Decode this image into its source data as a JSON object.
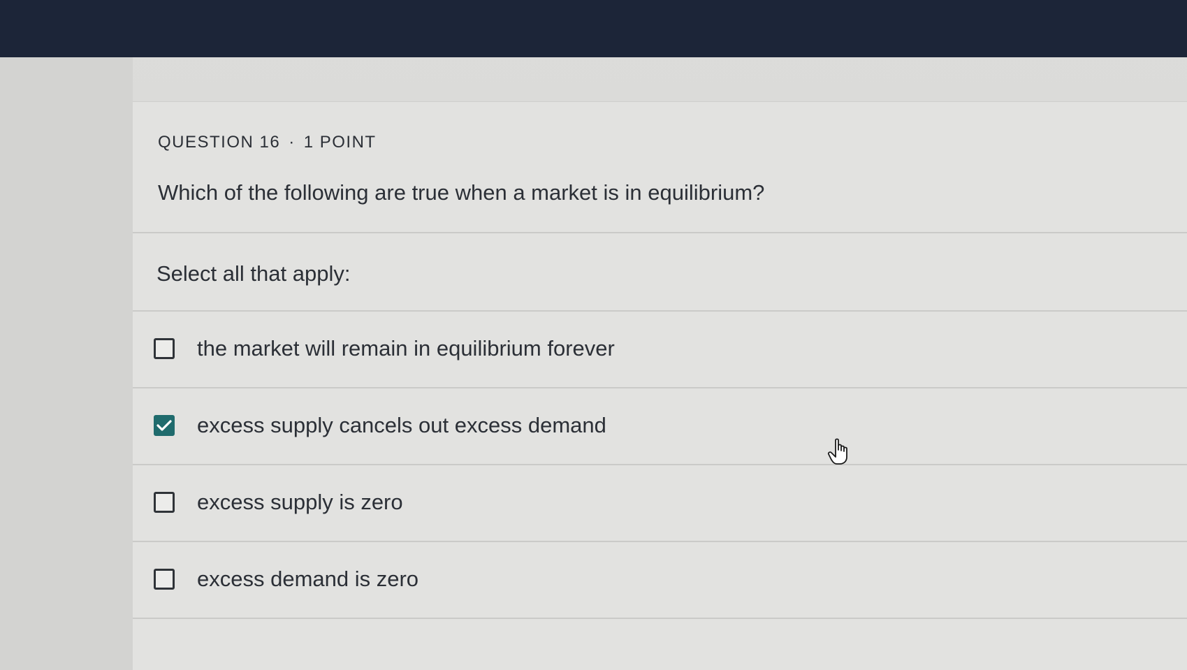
{
  "question": {
    "number_label": "QUESTION 16",
    "separator": "·",
    "points_label": "1 POINT",
    "text": "Which of the following are true when a market is in equilibrium?",
    "instructions": "Select all that apply:"
  },
  "options": [
    {
      "label": "the market will remain in equilibrium forever",
      "checked": false
    },
    {
      "label": "excess supply cancels out excess demand",
      "checked": true
    },
    {
      "label": "excess supply is zero",
      "checked": false
    },
    {
      "label": "excess demand is zero",
      "checked": false
    }
  ],
  "colors": {
    "top_bar": "#1c2538",
    "checked_fill": "#1f6b6d",
    "text": "#2b2f36"
  },
  "icons": {
    "checkmark": "checkmark-icon",
    "cursor": "hand-pointer-icon"
  }
}
